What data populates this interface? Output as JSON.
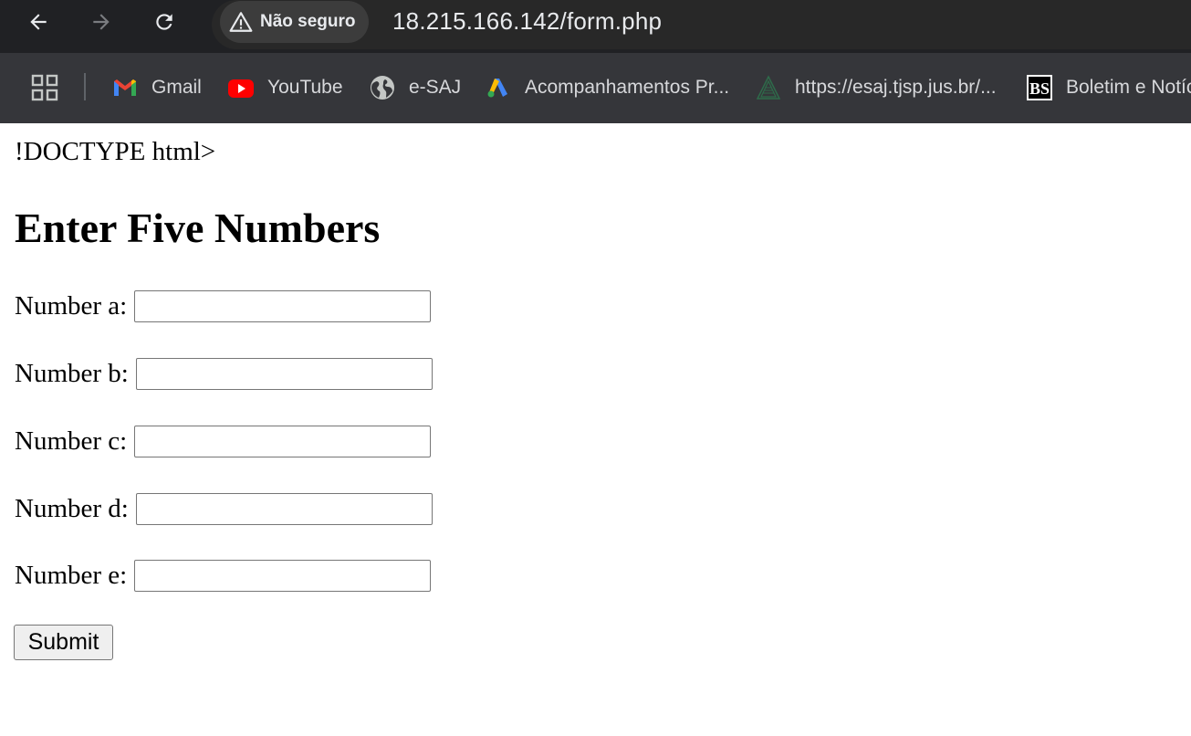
{
  "browser": {
    "security_label": "Não seguro",
    "url": "18.215.166.142/form.php",
    "bookmarks": [
      {
        "label": "Gmail",
        "icon": "gmail-icon"
      },
      {
        "label": "YouTube",
        "icon": "youtube-icon"
      },
      {
        "label": "e-SAJ",
        "icon": "globe-icon"
      },
      {
        "label": "Acompanhamentos Pr...",
        "icon": "google-ads-icon"
      },
      {
        "label": "https://esaj.tjsp.jus.br/...",
        "icon": "tjsp-icon"
      },
      {
        "label": "Boletim e Notíc",
        "icon": "bs-icon"
      }
    ]
  },
  "page": {
    "doctype_text": "!DOCTYPE html>",
    "heading": "Enter Five Numbers",
    "fields": [
      {
        "label": "Number a:",
        "value": ""
      },
      {
        "label": "Number b:",
        "value": ""
      },
      {
        "label": "Number c:",
        "value": ""
      },
      {
        "label": "Number d:",
        "value": ""
      },
      {
        "label": "Number e:",
        "value": ""
      }
    ],
    "submit_label": "Submit"
  },
  "colors": {
    "chrome_dark": "#202124",
    "bookmarks_bar": "#35363a",
    "omnibox": "#282828"
  }
}
